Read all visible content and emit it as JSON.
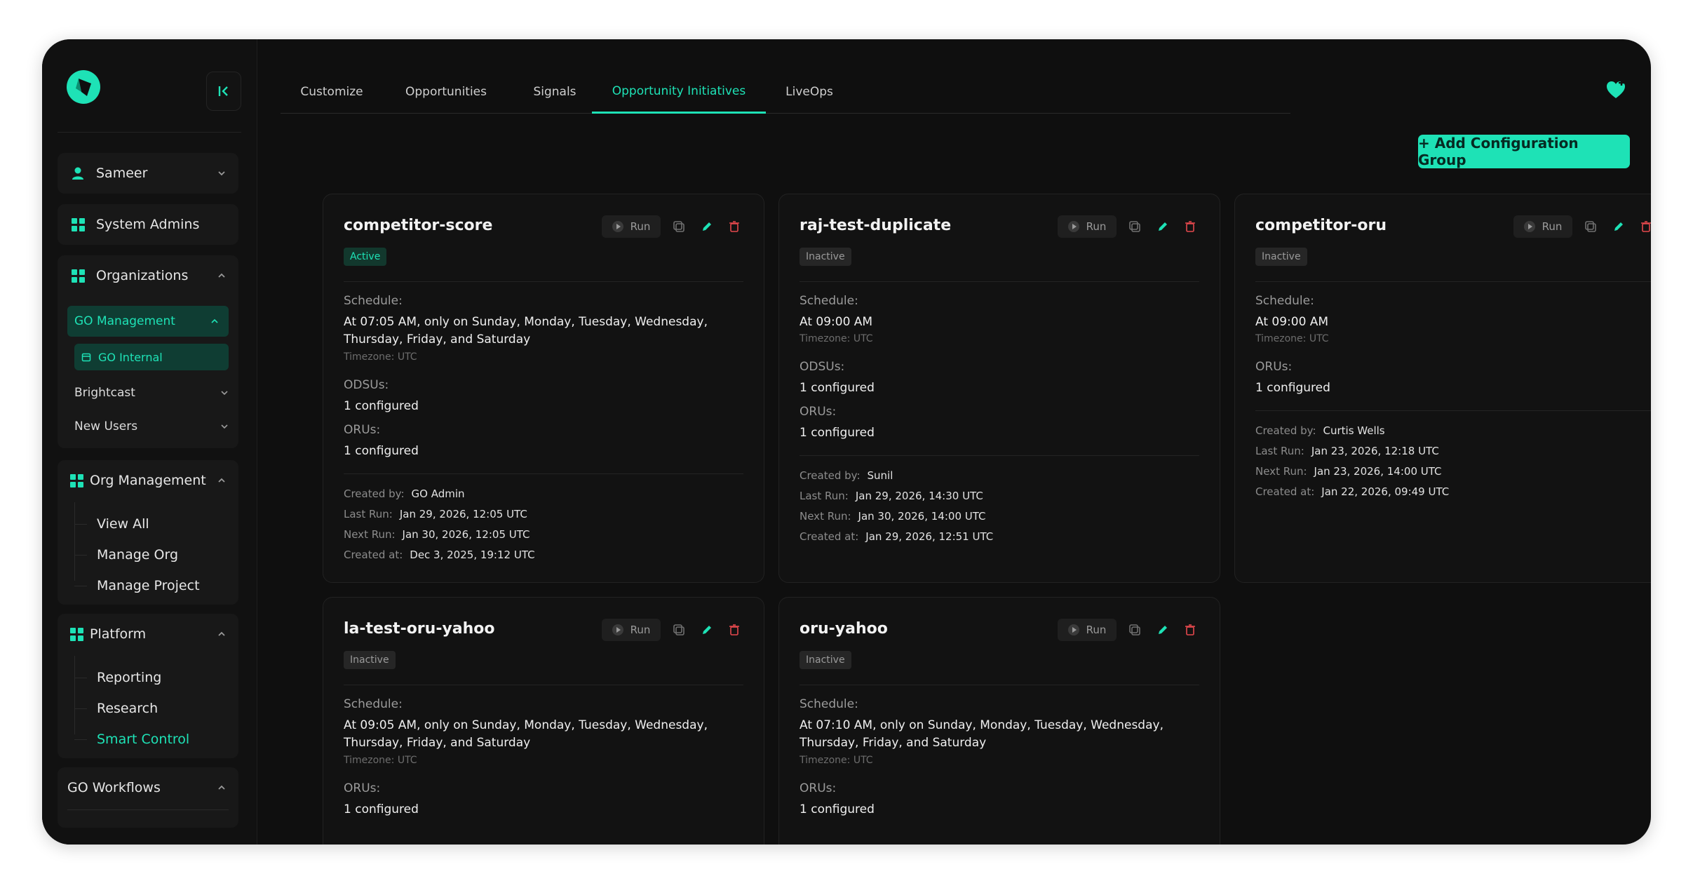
{
  "colors": {
    "accent": "#1ee2b6",
    "danger": "#e5484d",
    "bg": "#0f0f0f"
  },
  "sidebar": {
    "user": {
      "name": "Sameer",
      "icon": "user-icon"
    },
    "system_admins": "System Admins",
    "organizations": {
      "label": "Organizations",
      "go_management": "GO Management",
      "go_internal": "GO Internal",
      "brightcast": "Brightcast",
      "new_users": "New Users"
    },
    "org_management": {
      "label": "Org Management",
      "items": [
        "View All",
        "Manage Org",
        "Manage Project"
      ]
    },
    "platform": {
      "label": "Platform",
      "items": [
        "Reporting",
        "Research",
        "Smart Control"
      ]
    },
    "go_workflows": "GO Workflows"
  },
  "tabs": [
    "Customize",
    "Opportunities",
    "Signals",
    "Opportunity Initiatives",
    "LiveOps"
  ],
  "active_tab": "Opportunity Initiatives",
  "add_button": "+ Add Configuration Group",
  "labels": {
    "run": "Run",
    "schedule": "Schedule:",
    "odsus": "ODSUs:",
    "orus": "ORUs:",
    "created_by": "Created by:",
    "last_run": "Last Run:",
    "next_run": "Next Run:",
    "created_at": "Created at:"
  },
  "cards": [
    {
      "title": "competitor-score",
      "status": "Active",
      "schedule": "At 07:05 AM, only on Sunday, Monday, Tuesday, Wednesday, Thursday, Friday, and Saturday",
      "timezone": "Timezone: UTC",
      "odsus": "1 configured",
      "orus": "1 configured",
      "created_by": "GO Admin",
      "last_run": "Jan 29, 2026, 12:05 UTC",
      "next_run": "Jan 30, 2026, 12:05 UTC",
      "created_at": "Dec 3, 2025, 19:12 UTC"
    },
    {
      "title": "raj-test-duplicate",
      "status": "Inactive",
      "schedule": "At 09:00 AM",
      "timezone": "Timezone: UTC",
      "odsus": "1 configured",
      "orus": "1 configured",
      "created_by": "Sunil",
      "last_run": "Jan 29, 2026, 14:30 UTC",
      "next_run": "Jan 30, 2026, 14:00 UTC",
      "created_at": "Jan 29, 2026, 12:51 UTC"
    },
    {
      "title": "competitor-oru",
      "status": "Inactive",
      "schedule": "At 09:00 AM",
      "timezone": "Timezone: UTC",
      "orus": "1 configured",
      "created_by": "Curtis Wells",
      "last_run": "Jan 23, 2026, 12:18 UTC",
      "next_run": "Jan 23, 2026, 14:00 UTC",
      "created_at": "Jan 22, 2026, 09:49 UTC"
    },
    {
      "title": "la-test-oru-yahoo",
      "status": "Inactive",
      "schedule": "At 09:05 AM, only on Sunday, Monday, Tuesday, Wednesday, Thursday, Friday, and Saturday",
      "timezone": "Timezone: UTC",
      "orus": "1 configured"
    },
    {
      "title": "oru-yahoo",
      "status": "Inactive",
      "schedule": "At 07:10 AM, only on Sunday, Monday, Tuesday, Wednesday, Thursday, Friday, and Saturday",
      "timezone": "Timezone: UTC",
      "orus": "1 configured"
    }
  ]
}
